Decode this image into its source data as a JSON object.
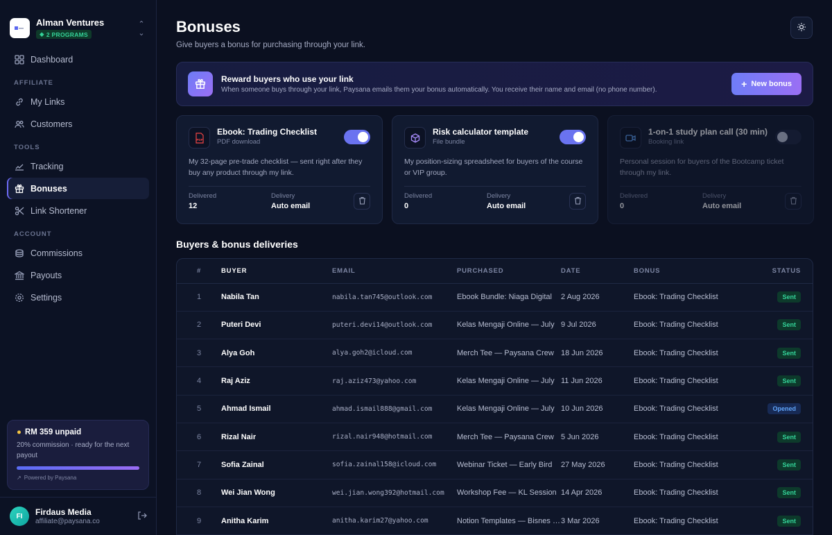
{
  "org": {
    "name": "Alman Ventures",
    "badge": "2 PROGRAMS"
  },
  "nav": {
    "dashboard": "Dashboard",
    "section_affiliate": "AFFILIATE",
    "my_links": "My Links",
    "customers": "Customers",
    "section_tools": "TOOLS",
    "tracking": "Tracking",
    "bonuses": "Bonuses",
    "link_shortener": "Link Shortener",
    "section_account": "ACCOUNT",
    "commissions": "Commissions",
    "payouts": "Payouts",
    "settings": "Settings"
  },
  "promo": {
    "title": "RM 359 unpaid",
    "subtitle": "20% commission · ready for the next payout",
    "progress": 1.0,
    "footer": "Powered by Paysana"
  },
  "user": {
    "initials": "FI",
    "name": "Firdaus Media",
    "email": "affiliate@paysana.co"
  },
  "page": {
    "title": "Bonuses",
    "subtitle": "Give buyers a bonus for purchasing through your link."
  },
  "banner": {
    "title": "Reward buyers who use your link",
    "description": "When someone buys through your link, Paysana emails them your bonus automatically. You receive their name and email (no phone number).",
    "button": "New bonus"
  },
  "bonuses": [
    {
      "title": "Ebook: Trading Checklist",
      "type": "PDF download",
      "icon": "pdf-icon",
      "enabled": true,
      "description": "My 32-page pre-trade checklist — sent right after they buy any product through my link.",
      "delivered_label": "Delivered",
      "delivered": "12",
      "delivery_label": "Delivery",
      "delivery": "Auto email"
    },
    {
      "title": "Risk calculator template",
      "type": "File bundle",
      "icon": "box-icon",
      "enabled": true,
      "description": "My position-sizing spreadsheet for buyers of the course or VIP group.",
      "delivered_label": "Delivered",
      "delivered": "0",
      "delivery_label": "Delivery",
      "delivery": "Auto email"
    },
    {
      "title": "1-on-1 study plan call (30 min)",
      "type": "Booking link",
      "icon": "video-icon",
      "enabled": false,
      "description": "Personal session for buyers of the Bootcamp ticket through my link.",
      "delivered_label": "Delivered",
      "delivered": "0",
      "delivery_label": "Delivery",
      "delivery": "Auto email"
    }
  ],
  "table": {
    "title": "Buyers & bonus deliveries",
    "headers": [
      "#",
      "BUYER",
      "EMAIL",
      "PURCHASED",
      "DATE",
      "BONUS",
      "STATUS"
    ],
    "rows": [
      {
        "n": "1",
        "buyer": "Nabila Tan",
        "email": "nabila.tan745@outlook.com",
        "purchased": "Ebook Bundle: Niaga Digital",
        "date": "2 Aug 2026",
        "bonus": "Ebook: Trading Checklist",
        "status": "Sent"
      },
      {
        "n": "2",
        "buyer": "Puteri Devi",
        "email": "puteri.devi14@outlook.com",
        "purchased": "Kelas Mengaji Online — July",
        "date": "9 Jul 2026",
        "bonus": "Ebook: Trading Checklist",
        "status": "Sent"
      },
      {
        "n": "3",
        "buyer": "Alya Goh",
        "email": "alya.goh2@icloud.com",
        "purchased": "Merch Tee — Paysana Crew",
        "date": "18 Jun 2026",
        "bonus": "Ebook: Trading Checklist",
        "status": "Sent"
      },
      {
        "n": "4",
        "buyer": "Raj Aziz",
        "email": "raj.aziz473@yahoo.com",
        "purchased": "Kelas Mengaji Online — July",
        "date": "11 Jun 2026",
        "bonus": "Ebook: Trading Checklist",
        "status": "Sent"
      },
      {
        "n": "5",
        "buyer": "Ahmad Ismail",
        "email": "ahmad.ismail888@gmail.com",
        "purchased": "Kelas Mengaji Online — July",
        "date": "10 Jun 2026",
        "bonus": "Ebook: Trading Checklist",
        "status": "Opened"
      },
      {
        "n": "6",
        "buyer": "Rizal Nair",
        "email": "rizal.nair948@hotmail.com",
        "purchased": "Merch Tee — Paysana Crew",
        "date": "5 Jun 2026",
        "bonus": "Ebook: Trading Checklist",
        "status": "Sent"
      },
      {
        "n": "7",
        "buyer": "Sofia Zainal",
        "email": "sofia.zainal158@icloud.com",
        "purchased": "Webinar Ticket — Early Bird",
        "date": "27 May 2026",
        "bonus": "Ebook: Trading Checklist",
        "status": "Sent"
      },
      {
        "n": "8",
        "buyer": "Wei Jian Wong",
        "email": "wei.jian.wong392@hotmail.com",
        "purchased": "Workshop Fee — KL Session",
        "date": "14 Apr 2026",
        "bonus": "Ebook: Trading Checklist",
        "status": "Sent"
      },
      {
        "n": "9",
        "buyer": "Anitha Karim",
        "email": "anitha.karim27@yahoo.com",
        "purchased": "Notion Templates — Bisnes Kit",
        "date": "3 Mar 2026",
        "bonus": "Ebook: Trading Checklist",
        "status": "Sent"
      }
    ]
  },
  "colors": {
    "accent": "#6d6af5",
    "sent": "#34d399",
    "opened": "#60a5fa",
    "background": "#0b1020"
  }
}
